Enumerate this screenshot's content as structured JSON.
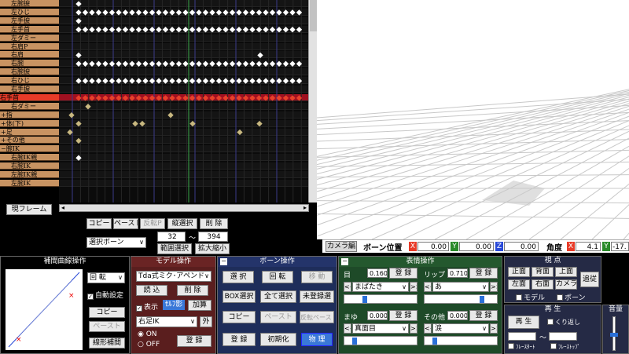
{
  "timeline": {
    "labels": [
      {
        "text": "左腕捩",
        "kind": "sub"
      },
      {
        "text": "左ひじ",
        "kind": "sub"
      },
      {
        "text": "左手捩",
        "kind": "sub"
      },
      {
        "text": "左手首",
        "kind": "sub"
      },
      {
        "text": "左ダミー",
        "kind": "sub"
      },
      {
        "text": "右肩P",
        "kind": "sub"
      },
      {
        "text": "右肩",
        "kind": "sub"
      },
      {
        "text": "右腕",
        "kind": "sub"
      },
      {
        "text": "右腕捩",
        "kind": "sub"
      },
      {
        "text": "右ひじ",
        "kind": "sub"
      },
      {
        "text": "右手捩",
        "kind": "sub"
      },
      {
        "text": "右手首",
        "kind": "red"
      },
      {
        "text": "右ダミー",
        "kind": "sub"
      },
      {
        "text": "+指",
        "kind": "top"
      },
      {
        "text": "+体(下)",
        "kind": "top"
      },
      {
        "text": "+足",
        "kind": "top"
      },
      {
        "text": "+その他",
        "kind": "top"
      },
      {
        "text": "−腕IK",
        "kind": "top"
      },
      {
        "text": "右腕IK親",
        "kind": "sub"
      },
      {
        "text": "右腕IK",
        "kind": "sub"
      },
      {
        "text": "左腕IK親",
        "kind": "sub"
      },
      {
        "text": "左腕IK",
        "kind": "sub"
      }
    ],
    "current_frame_label": "現フレーム",
    "buttons": {
      "copy": "コピー",
      "paste": "ペースト",
      "flip": "反転P",
      "vsel": "縦選択",
      "del": "削 除",
      "range": "範囲選択",
      "zoom": "拡大縮小"
    },
    "bone_select": "選択ボーン",
    "range_from": "32",
    "range_sep": "〜",
    "range_to": "394"
  },
  "viewport": {
    "camera_tab": "カメラ編",
    "bone_pos_label": "ボーン位置",
    "x_label": "X",
    "y_label": "Y",
    "z_label": "Z",
    "pos_x": "0.00",
    "pos_y": "0.00",
    "pos_z": "0.00",
    "angle_label": "角度",
    "ang_x": "4.1",
    "ang_y": "-17."
  },
  "interp": {
    "title": "補間曲線操作",
    "rotate": "回 転",
    "auto": "自動設定",
    "copy": "コピー",
    "paste": "ペースト",
    "linear": "線形補間"
  },
  "model": {
    "title": "モデル操作",
    "model_select": "Tda式ミク･アペンド",
    "load": "読 込",
    "delete": "削 除",
    "show": "表示",
    "self_shadow": "ｾﾙﾌ影",
    "add": "加算",
    "ik_select": "右足IK",
    "outside": "外",
    "on": "ON",
    "off": "OFF",
    "register": "登 録"
  },
  "bone": {
    "title": "ボーン操作",
    "select": "選 択",
    "rotate": "回 転",
    "move": "移 動",
    "box": "BOX選択",
    "all": "全て選択",
    "unreg": "未登録選",
    "copy": "コピー",
    "paste": "ペースト",
    "flip_paste": "反転ペースト",
    "register": "登 録",
    "init": "初期化",
    "physics": "物 理"
  },
  "face": {
    "title": "表情操作",
    "eye": "目",
    "eye_val": "0.160",
    "eye_reg": "登 録",
    "eye_sel": "まばたき",
    "lip": "リップ",
    "lip_val": "0.710",
    "lip_reg": "登 録",
    "lip_sel": "あ",
    "brow": "まゆ",
    "brow_val": "0.000",
    "brow_reg": "登 録",
    "brow_sel": "真面目",
    "other": "その他",
    "other_val": "0.000",
    "other_reg": "登 録",
    "other_sel": "涙",
    "prev": "<<",
    "next": ">>",
    "eye_level": 0.16,
    "lip_level": 0.71,
    "brow_level": 0.0,
    "other_level": 0.0
  },
  "viewpoint": {
    "title": "視 点",
    "front": "正面",
    "back": "背面",
    "top": "上面",
    "follow": "追従",
    "left": "左面",
    "right": "右面",
    "camera": "カメラ",
    "model": "モデル",
    "bone": "ボーン"
  },
  "play": {
    "title": "再 生",
    "play": "再 生",
    "repeat": "くり返し",
    "sep": "〜",
    "start": "ﾌﾚｰｽﾀｰﾄ",
    "stop": "ﾌﾚｰｽﾄｯﾌﾟ"
  },
  "volume": {
    "title": "音量"
  },
  "colors": {
    "accent": "#2a70d8",
    "key": "#ffffff",
    "key_red": "#e83b28",
    "model_bg": "#5a1e1e",
    "bone_bg": "#1e2d5a",
    "face_bg": "#1e4a28",
    "view_bg": "#252a45"
  }
}
